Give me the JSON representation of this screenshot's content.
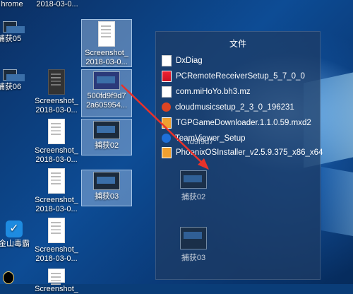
{
  "desktop": {
    "icons": [
      {
        "label": "hrome"
      },
      {
        "label": "2018-03-0..."
      },
      {
        "label": "捕获05"
      },
      {
        "label": "Screenshot_\n2018-03-0..."
      },
      {
        "label": "捕获06"
      },
      {
        "label": "Screenshot_\n2018-03-0..."
      },
      {
        "label": "500fd9f9d7\n2a605954..."
      },
      {
        "label": "Screenshot_\n2018-03-0..."
      },
      {
        "label": "捕获02"
      },
      {
        "label": "Screenshot_\n2018-03-0..."
      },
      {
        "label": "捕获03"
      },
      {
        "label": "金山毒霸"
      },
      {
        "label": "Screenshot_\n2018-03-0..."
      },
      {
        "label": "Screenshot_"
      }
    ]
  },
  "popup": {
    "title": "文件",
    "files": [
      {
        "name": "DxDiag",
        "icon": "doc"
      },
      {
        "name": "PCRemoteReceiverSetup_5_7_0_0",
        "icon": "exe"
      },
      {
        "name": "com.miHoYo.bh3.mz",
        "icon": "doc"
      },
      {
        "name": "cloudmusicsetup_2_3_0_196231",
        "icon": "red"
      },
      {
        "name": "TGPGameDownloader.1.1.0.59.mxd2",
        "icon": "org"
      },
      {
        "name": "TeamViewer_Setup",
        "icon": "blue"
      },
      {
        "name": "PhoenixOSInstaller_v2.5.9.375_x86_x64",
        "icon": "org"
      }
    ],
    "ghosts": [
      "fd9f9d7",
      "捕获02",
      "捕获03"
    ]
  }
}
